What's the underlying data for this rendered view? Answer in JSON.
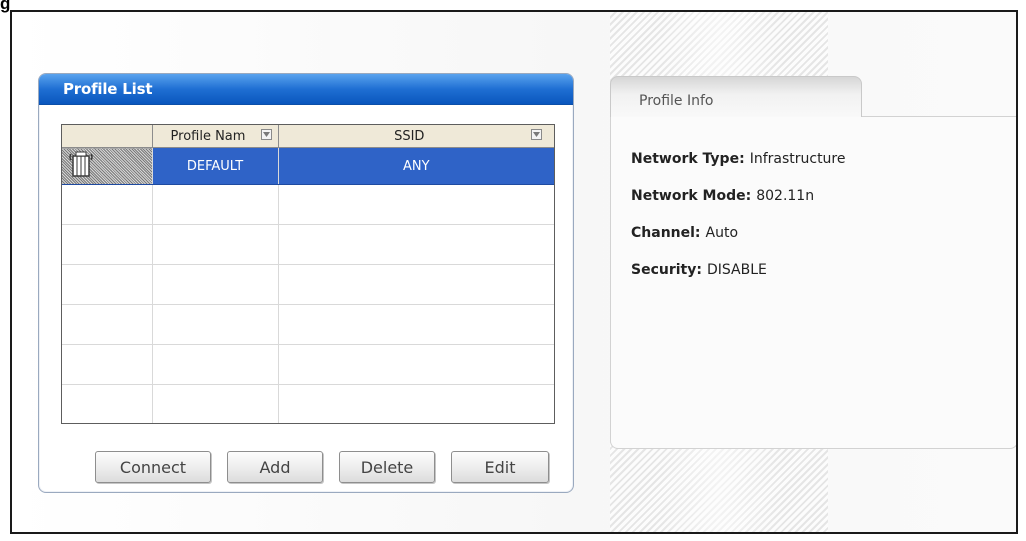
{
  "figure_label": "g",
  "profile_list": {
    "title": "Profile List",
    "columns": [
      "",
      "Profile Nam",
      "SSID"
    ],
    "rows": [
      {
        "profile_name": "DEFAULT",
        "ssid": "ANY",
        "selected": true,
        "icon": "ap-tower-icon"
      }
    ],
    "buttons": {
      "connect": "Connect",
      "add": "Add",
      "delete": "Delete",
      "edit": "Edit"
    },
    "colors": {
      "header": "#1f6fd3",
      "selected_row": "#2f63c7"
    }
  },
  "profile_info": {
    "tab_label": "Profile Info",
    "network_type_label": "Network Type:",
    "network_type_value": "Infrastructure",
    "network_mode_label": "Network Mode:",
    "network_mode_value": "802.11n",
    "channel_label": "Channel:",
    "channel_value": "Auto",
    "security_label": "Security:",
    "security_value": "DISABLE"
  }
}
